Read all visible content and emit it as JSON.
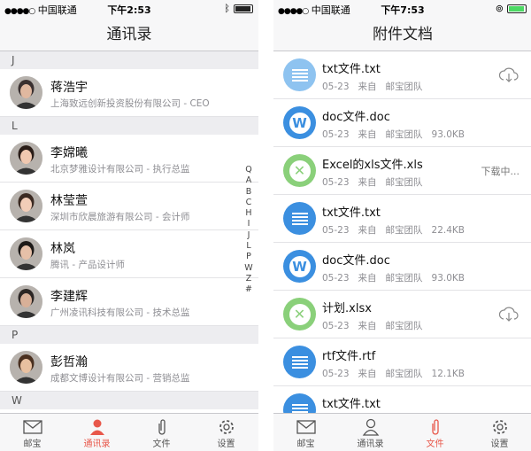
{
  "left": {
    "status": {
      "carrier": "中国联通",
      "time": "下午2:53"
    },
    "title": "通讯录",
    "sections": [
      {
        "letter": "J",
        "contacts": [
          {
            "name": "蒋浩宇",
            "desc": "上海致远创新投资股份有限公司 - CEO"
          }
        ]
      },
      {
        "letter": "L",
        "contacts": [
          {
            "name": "李嫦曦",
            "desc": "北京梦雅设计有限公司 - 执行总监"
          },
          {
            "name": "林莹萱",
            "desc": "深圳市欣晨旅游有限公司 - 会计师"
          },
          {
            "name": "林岚",
            "desc": "腾讯 - 产品设计师"
          },
          {
            "name": "李建辉",
            "desc": "广州凌讯科技有限公司 - 技术总监"
          }
        ]
      },
      {
        "letter": "P",
        "contacts": [
          {
            "name": "彭哲瀚",
            "desc": "成都文博设计有限公司 - 营销总监"
          }
        ]
      },
      {
        "letter": "W",
        "contacts": []
      }
    ],
    "index": [
      "Q",
      "A",
      "B",
      "C",
      "H",
      "I",
      "J",
      "L",
      "P",
      "W",
      "Z",
      "#"
    ],
    "tabs": [
      "邮宝",
      "通讯录",
      "文件",
      "设置"
    ]
  },
  "right": {
    "status": {
      "carrier": "中国联通",
      "time": "下午7:53"
    },
    "title": "附件文档",
    "files": [
      {
        "name": "txt文件.txt",
        "date": "05-23",
        "from": "来自",
        "sender": "邮宝团队",
        "size": "",
        "kind": "txt-light",
        "action": "cloud"
      },
      {
        "name": "doc文件.doc",
        "date": "05-23",
        "from": "来自",
        "sender": "邮宝团队",
        "size": "93.0KB",
        "kind": "doc",
        "action": ""
      },
      {
        "name": "Excel的xls文件.xls",
        "date": "05-23",
        "from": "来自",
        "sender": "邮宝团队",
        "size": "",
        "kind": "xls",
        "action": "下载中..."
      },
      {
        "name": "txt文件.txt",
        "date": "05-23",
        "from": "来自",
        "sender": "邮宝团队",
        "size": "22.4KB",
        "kind": "txt",
        "action": ""
      },
      {
        "name": "doc文件.doc",
        "date": "05-23",
        "from": "来自",
        "sender": "邮宝团队",
        "size": "93.0KB",
        "kind": "doc",
        "action": ""
      },
      {
        "name": "计划.xlsx",
        "date": "05-23",
        "from": "来自",
        "sender": "邮宝团队",
        "size": "",
        "kind": "xls",
        "action": "cloud"
      },
      {
        "name": "rtf文件.rtf",
        "date": "05-23",
        "from": "来自",
        "sender": "邮宝团队",
        "size": "12.1KB",
        "kind": "txt",
        "action": ""
      },
      {
        "name": "txt文件.txt",
        "date": "",
        "from": "",
        "sender": "",
        "size": "",
        "kind": "txt",
        "action": ""
      }
    ],
    "tabs": [
      "邮宝",
      "通讯录",
      "文件",
      "设置"
    ]
  },
  "colors": {
    "accent": "#e8574a",
    "blue": "#3b8fe0",
    "lightblue": "#8ec3f0",
    "green": "#8ad07a"
  }
}
